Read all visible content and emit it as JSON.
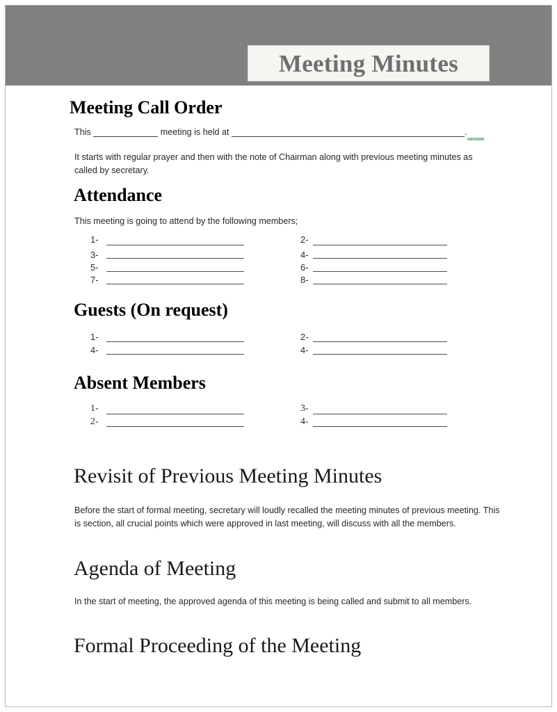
{
  "document": {
    "title": "Meeting Minutes"
  },
  "sections": {
    "call_order": {
      "heading": "Meeting Call Order",
      "fill_line_prefix": "This",
      "fill_line_middle": "meeting is held at",
      "fill_line_suffix": ".",
      "body": "It starts with regular prayer and then with the note of Chairman along with previous meeting minutes as called by secretary."
    },
    "attendance": {
      "heading": "Attendance",
      "intro": "This meeting is going to attend by the following members;",
      "left_numbers": [
        "1-",
        "3-",
        "5-",
        "7-"
      ],
      "right_numbers": [
        "2-",
        "4-",
        "6-",
        "8-"
      ]
    },
    "guests": {
      "heading": "Guests (On request)",
      "left_numbers": [
        "1-",
        "4-"
      ],
      "right_numbers": [
        "2-",
        "4-"
      ]
    },
    "absent": {
      "heading": "Absent Members",
      "left_numbers": [
        "1-",
        "2-"
      ],
      "right_numbers": [
        "3-",
        "4-"
      ]
    },
    "revisit": {
      "heading": "Revisit of Previous Meeting Minutes",
      "body": "Before the start of formal meeting, secretary will loudly recalled the meeting minutes of previous meeting. This is section, all crucial points which were approved in last meeting, will discuss with all the members."
    },
    "agenda": {
      "heading": "Agenda of Meeting",
      "body": "In the start of meeting, the approved agenda of this meeting is being called and submit to all members."
    },
    "formal": {
      "heading": "Formal Proceeding of the Meeting"
    }
  },
  "colors": {
    "header_band": "#808080",
    "title_box_bg": "#f7f5f1",
    "title_text": "#6f6f6f",
    "page_border": "#b8b8b8",
    "rule_line": "#4a4a4a",
    "spellcheck_underline": "#1f7a3d"
  }
}
